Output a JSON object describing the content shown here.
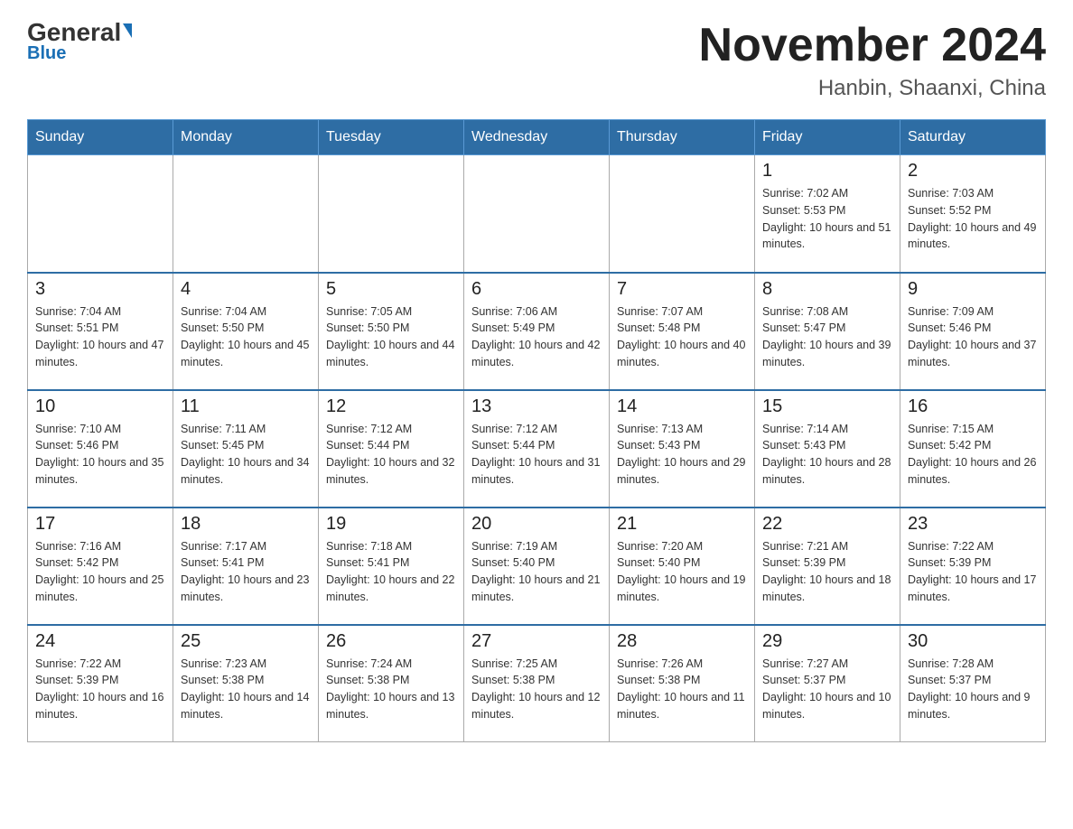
{
  "header": {
    "logo_general": "General",
    "logo_blue": "Blue",
    "calendar_title": "November 2024",
    "calendar_subtitle": "Hanbin, Shaanxi, China"
  },
  "weekdays": [
    "Sunday",
    "Monday",
    "Tuesday",
    "Wednesday",
    "Thursday",
    "Friday",
    "Saturday"
  ],
  "weeks": [
    [
      {
        "day": "",
        "sunrise": "",
        "sunset": "",
        "daylight": ""
      },
      {
        "day": "",
        "sunrise": "",
        "sunset": "",
        "daylight": ""
      },
      {
        "day": "",
        "sunrise": "",
        "sunset": "",
        "daylight": ""
      },
      {
        "day": "",
        "sunrise": "",
        "sunset": "",
        "daylight": ""
      },
      {
        "day": "",
        "sunrise": "",
        "sunset": "",
        "daylight": ""
      },
      {
        "day": "1",
        "sunrise": "Sunrise: 7:02 AM",
        "sunset": "Sunset: 5:53 PM",
        "daylight": "Daylight: 10 hours and 51 minutes."
      },
      {
        "day": "2",
        "sunrise": "Sunrise: 7:03 AM",
        "sunset": "Sunset: 5:52 PM",
        "daylight": "Daylight: 10 hours and 49 minutes."
      }
    ],
    [
      {
        "day": "3",
        "sunrise": "Sunrise: 7:04 AM",
        "sunset": "Sunset: 5:51 PM",
        "daylight": "Daylight: 10 hours and 47 minutes."
      },
      {
        "day": "4",
        "sunrise": "Sunrise: 7:04 AM",
        "sunset": "Sunset: 5:50 PM",
        "daylight": "Daylight: 10 hours and 45 minutes."
      },
      {
        "day": "5",
        "sunrise": "Sunrise: 7:05 AM",
        "sunset": "Sunset: 5:50 PM",
        "daylight": "Daylight: 10 hours and 44 minutes."
      },
      {
        "day": "6",
        "sunrise": "Sunrise: 7:06 AM",
        "sunset": "Sunset: 5:49 PM",
        "daylight": "Daylight: 10 hours and 42 minutes."
      },
      {
        "day": "7",
        "sunrise": "Sunrise: 7:07 AM",
        "sunset": "Sunset: 5:48 PM",
        "daylight": "Daylight: 10 hours and 40 minutes."
      },
      {
        "day": "8",
        "sunrise": "Sunrise: 7:08 AM",
        "sunset": "Sunset: 5:47 PM",
        "daylight": "Daylight: 10 hours and 39 minutes."
      },
      {
        "day": "9",
        "sunrise": "Sunrise: 7:09 AM",
        "sunset": "Sunset: 5:46 PM",
        "daylight": "Daylight: 10 hours and 37 minutes."
      }
    ],
    [
      {
        "day": "10",
        "sunrise": "Sunrise: 7:10 AM",
        "sunset": "Sunset: 5:46 PM",
        "daylight": "Daylight: 10 hours and 35 minutes."
      },
      {
        "day": "11",
        "sunrise": "Sunrise: 7:11 AM",
        "sunset": "Sunset: 5:45 PM",
        "daylight": "Daylight: 10 hours and 34 minutes."
      },
      {
        "day": "12",
        "sunrise": "Sunrise: 7:12 AM",
        "sunset": "Sunset: 5:44 PM",
        "daylight": "Daylight: 10 hours and 32 minutes."
      },
      {
        "day": "13",
        "sunrise": "Sunrise: 7:12 AM",
        "sunset": "Sunset: 5:44 PM",
        "daylight": "Daylight: 10 hours and 31 minutes."
      },
      {
        "day": "14",
        "sunrise": "Sunrise: 7:13 AM",
        "sunset": "Sunset: 5:43 PM",
        "daylight": "Daylight: 10 hours and 29 minutes."
      },
      {
        "day": "15",
        "sunrise": "Sunrise: 7:14 AM",
        "sunset": "Sunset: 5:43 PM",
        "daylight": "Daylight: 10 hours and 28 minutes."
      },
      {
        "day": "16",
        "sunrise": "Sunrise: 7:15 AM",
        "sunset": "Sunset: 5:42 PM",
        "daylight": "Daylight: 10 hours and 26 minutes."
      }
    ],
    [
      {
        "day": "17",
        "sunrise": "Sunrise: 7:16 AM",
        "sunset": "Sunset: 5:42 PM",
        "daylight": "Daylight: 10 hours and 25 minutes."
      },
      {
        "day": "18",
        "sunrise": "Sunrise: 7:17 AM",
        "sunset": "Sunset: 5:41 PM",
        "daylight": "Daylight: 10 hours and 23 minutes."
      },
      {
        "day": "19",
        "sunrise": "Sunrise: 7:18 AM",
        "sunset": "Sunset: 5:41 PM",
        "daylight": "Daylight: 10 hours and 22 minutes."
      },
      {
        "day": "20",
        "sunrise": "Sunrise: 7:19 AM",
        "sunset": "Sunset: 5:40 PM",
        "daylight": "Daylight: 10 hours and 21 minutes."
      },
      {
        "day": "21",
        "sunrise": "Sunrise: 7:20 AM",
        "sunset": "Sunset: 5:40 PM",
        "daylight": "Daylight: 10 hours and 19 minutes."
      },
      {
        "day": "22",
        "sunrise": "Sunrise: 7:21 AM",
        "sunset": "Sunset: 5:39 PM",
        "daylight": "Daylight: 10 hours and 18 minutes."
      },
      {
        "day": "23",
        "sunrise": "Sunrise: 7:22 AM",
        "sunset": "Sunset: 5:39 PM",
        "daylight": "Daylight: 10 hours and 17 minutes."
      }
    ],
    [
      {
        "day": "24",
        "sunrise": "Sunrise: 7:22 AM",
        "sunset": "Sunset: 5:39 PM",
        "daylight": "Daylight: 10 hours and 16 minutes."
      },
      {
        "day": "25",
        "sunrise": "Sunrise: 7:23 AM",
        "sunset": "Sunset: 5:38 PM",
        "daylight": "Daylight: 10 hours and 14 minutes."
      },
      {
        "day": "26",
        "sunrise": "Sunrise: 7:24 AM",
        "sunset": "Sunset: 5:38 PM",
        "daylight": "Daylight: 10 hours and 13 minutes."
      },
      {
        "day": "27",
        "sunrise": "Sunrise: 7:25 AM",
        "sunset": "Sunset: 5:38 PM",
        "daylight": "Daylight: 10 hours and 12 minutes."
      },
      {
        "day": "28",
        "sunrise": "Sunrise: 7:26 AM",
        "sunset": "Sunset: 5:38 PM",
        "daylight": "Daylight: 10 hours and 11 minutes."
      },
      {
        "day": "29",
        "sunrise": "Sunrise: 7:27 AM",
        "sunset": "Sunset: 5:37 PM",
        "daylight": "Daylight: 10 hours and 10 minutes."
      },
      {
        "day": "30",
        "sunrise": "Sunrise: 7:28 AM",
        "sunset": "Sunset: 5:37 PM",
        "daylight": "Daylight: 10 hours and 9 minutes."
      }
    ]
  ]
}
